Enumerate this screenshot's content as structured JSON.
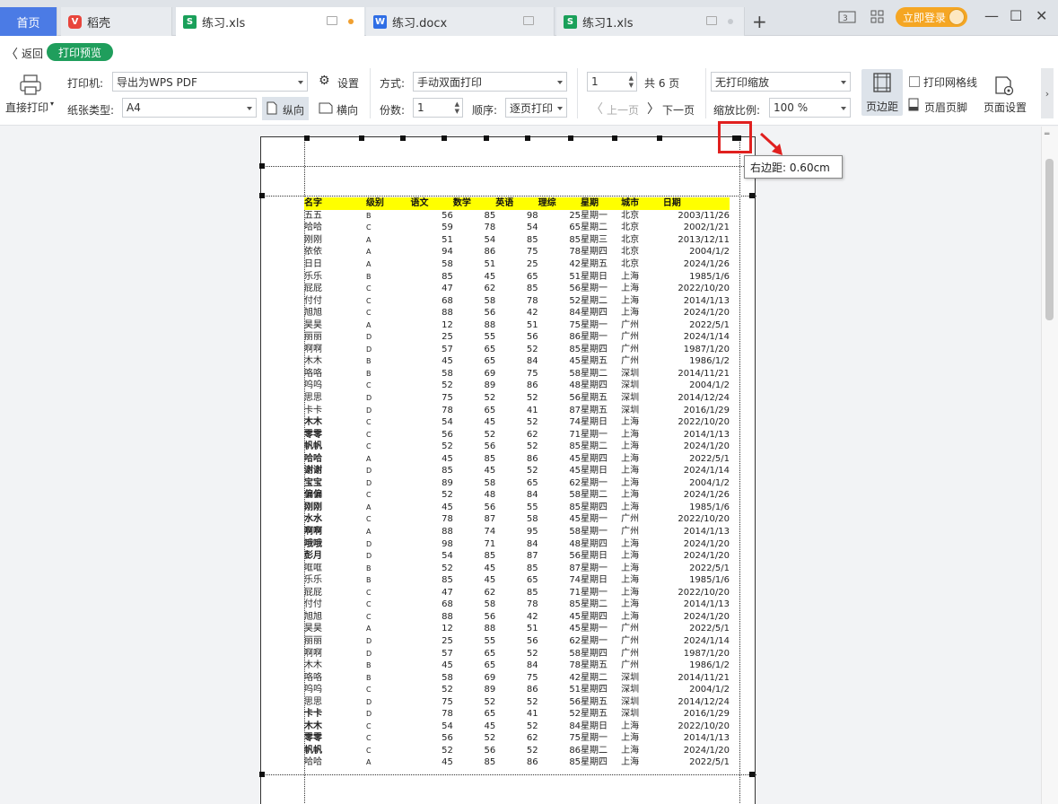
{
  "tabs": [
    {
      "label": "首页",
      "kind": "home"
    },
    {
      "label": "稻壳",
      "icon": "docer-icon"
    },
    {
      "label": "练习.xls",
      "icon": "spreadsheet-icon",
      "active": true,
      "modified": true
    },
    {
      "label": "练习.docx",
      "icon": "word-document-icon"
    },
    {
      "label": "练习1.xls",
      "icon": "spreadsheet-icon"
    }
  ],
  "header": {
    "login_label": "立即登录"
  },
  "toolbar": {
    "back_label": "返回",
    "preview_badge": "打印预览",
    "direct_print_label": "直接打印",
    "printer_label": "打印机:",
    "printer_value": "导出为WPS PDF",
    "settings_label": "设置",
    "paper_type_label": "纸张类型:",
    "paper_type_value": "A4",
    "portrait_label": "纵向",
    "landscape_label": "横向",
    "mode_label": "方式:",
    "mode_value": "手动双面打印",
    "copies_label": "份数:",
    "copies_value": "1",
    "order_label": "顺序:",
    "order_value": "逐页打印",
    "page_value": "1",
    "total_pages": "共 6 页",
    "prev_page_label": "上一页",
    "next_page_label": "下一页",
    "scaling_value": "无打印缩放",
    "zoom_label": "缩放比例:",
    "zoom_value": "100 %",
    "margins_label": "页边距",
    "gridlines_label": "打印网格线",
    "header_footer_label": "页眉页脚",
    "page_setup_label": "页面设置"
  },
  "tooltip": {
    "text": "右边距:   0.60cm"
  },
  "sheet": {
    "headers": [
      "名字",
      "级别",
      "语文",
      "数学",
      "英语",
      "理综",
      "星期",
      "城市",
      "日期"
    ],
    "rows": [
      [
        "五五",
        "B",
        "56",
        "85",
        "98",
        "25",
        "星期一",
        "北京",
        "2003/11/26"
      ],
      [
        "哈哈",
        "C",
        "59",
        "78",
        "54",
        "65",
        "星期二",
        "北京",
        "2002/1/21"
      ],
      [
        "刚刚",
        "A",
        "51",
        "54",
        "85",
        "85",
        "星期三",
        "北京",
        "2013/12/11"
      ],
      [
        "依依",
        "A",
        "94",
        "86",
        "75",
        "78",
        "星期四",
        "北京",
        "2004/1/2"
      ],
      [
        "日日",
        "A",
        "58",
        "51",
        "25",
        "42",
        "星期五",
        "北京",
        "2024/1/26"
      ],
      [
        "乐乐",
        "B",
        "85",
        "45",
        "65",
        "51",
        "星期日",
        "上海",
        "1985/1/6"
      ],
      [
        "屁屁",
        "C",
        "47",
        "62",
        "85",
        "56",
        "星期一",
        "上海",
        "2022/10/20"
      ],
      [
        "付付",
        "C",
        "68",
        "58",
        "78",
        "52",
        "星期二",
        "上海",
        "2014/1/13"
      ],
      [
        "旭旭",
        "C",
        "88",
        "56",
        "42",
        "84",
        "星期四",
        "上海",
        "2024/1/20"
      ],
      [
        "昊昊",
        "A",
        "12",
        "88",
        "51",
        "75",
        "星期一",
        "广州",
        "2022/5/1"
      ],
      [
        "丽丽",
        "D",
        "25",
        "55",
        "56",
        "86",
        "星期一",
        "广州",
        "2024/1/14"
      ],
      [
        "啊啊",
        "D",
        "57",
        "65",
        "52",
        "85",
        "星期四",
        "广州",
        "1987/1/20"
      ],
      [
        "木木",
        "B",
        "45",
        "65",
        "84",
        "45",
        "星期五",
        "广州",
        "1986/1/2"
      ],
      [
        "咯咯",
        "B",
        "58",
        "69",
        "75",
        "58",
        "星期二",
        "深圳",
        "2014/11/21"
      ],
      [
        "呜呜",
        "C",
        "52",
        "89",
        "86",
        "48",
        "星期四",
        "深圳",
        "2004/1/2"
      ],
      [
        "思思",
        "D",
        "75",
        "52",
        "52",
        "56",
        "星期五",
        "深圳",
        "2014/12/24"
      ],
      [
        "卡卡",
        "D",
        "78",
        "65",
        "41",
        "87",
        "星期五",
        "深圳",
        "2016/1/29"
      ],
      [
        "木木",
        "C",
        "54",
        "45",
        "52",
        "74",
        "星期日",
        "上海",
        "2022/10/20"
      ],
      [
        "零零",
        "C",
        "56",
        "52",
        "62",
        "71",
        "星期一",
        "上海",
        "2014/1/13"
      ],
      [
        "帆帆",
        "C",
        "52",
        "56",
        "52",
        "85",
        "星期二",
        "上海",
        "2024/1/20"
      ],
      [
        "哈哈",
        "A",
        "45",
        "85",
        "86",
        "45",
        "星期四",
        "上海",
        "2022/5/1"
      ],
      [
        "谢谢",
        "D",
        "85",
        "45",
        "52",
        "45",
        "星期日",
        "上海",
        "2024/1/14"
      ],
      [
        "宝宝",
        "D",
        "89",
        "58",
        "65",
        "62",
        "星期一",
        "上海",
        "2004/1/2"
      ],
      [
        "偏偏",
        "C",
        "52",
        "48",
        "84",
        "58",
        "星期二",
        "上海",
        "2024/1/26"
      ],
      [
        "刚刚",
        "A",
        "45",
        "56",
        "55",
        "85",
        "星期四",
        "上海",
        "1985/1/6"
      ],
      [
        "水水",
        "C",
        "78",
        "87",
        "58",
        "45",
        "星期一",
        "广州",
        "2022/10/20"
      ],
      [
        "啊啊",
        "A",
        "88",
        "74",
        "95",
        "58",
        "星期一",
        "广州",
        "2014/1/13"
      ],
      [
        "哦哦",
        "D",
        "98",
        "71",
        "84",
        "48",
        "星期四",
        "上海",
        "2024/1/20"
      ],
      [
        "彭月",
        "D",
        "54",
        "85",
        "87",
        "56",
        "星期日",
        "上海",
        "2024/1/20"
      ],
      [
        "哐哐",
        "B",
        "52",
        "45",
        "85",
        "87",
        "星期一",
        "上海",
        "2022/5/1"
      ],
      [
        "乐乐",
        "B",
        "85",
        "45",
        "65",
        "74",
        "星期日",
        "上海",
        "1985/1/6"
      ],
      [
        "屁屁",
        "C",
        "47",
        "62",
        "85",
        "71",
        "星期一",
        "上海",
        "2022/10/20"
      ],
      [
        "付付",
        "C",
        "68",
        "58",
        "78",
        "85",
        "星期二",
        "上海",
        "2014/1/13"
      ],
      [
        "旭旭",
        "C",
        "88",
        "56",
        "42",
        "45",
        "星期四",
        "上海",
        "2024/1/20"
      ],
      [
        "昊昊",
        "A",
        "12",
        "88",
        "51",
        "45",
        "星期一",
        "广州",
        "2022/5/1"
      ],
      [
        "丽丽",
        "D",
        "25",
        "55",
        "56",
        "62",
        "星期一",
        "广州",
        "2024/1/14"
      ],
      [
        "啊啊",
        "D",
        "57",
        "65",
        "52",
        "58",
        "星期四",
        "广州",
        "1987/1/20"
      ],
      [
        "木木",
        "B",
        "45",
        "65",
        "84",
        "78",
        "星期五",
        "广州",
        "1986/1/2"
      ],
      [
        "咯咯",
        "B",
        "58",
        "69",
        "75",
        "42",
        "星期二",
        "深圳",
        "2014/11/21"
      ],
      [
        "呜呜",
        "C",
        "52",
        "89",
        "86",
        "51",
        "星期四",
        "深圳",
        "2004/1/2"
      ],
      [
        "思思",
        "D",
        "75",
        "52",
        "52",
        "56",
        "星期五",
        "深圳",
        "2014/12/24"
      ],
      [
        "卡卡",
        "D",
        "78",
        "65",
        "41",
        "52",
        "星期五",
        "深圳",
        "2016/1/29"
      ],
      [
        "木木",
        "C",
        "54",
        "45",
        "52",
        "84",
        "星期日",
        "上海",
        "2022/10/20"
      ],
      [
        "零零",
        "C",
        "56",
        "52",
        "62",
        "75",
        "星期一",
        "上海",
        "2014/1/13"
      ],
      [
        "帆帆",
        "C",
        "52",
        "56",
        "52",
        "86",
        "星期二",
        "上海",
        "2024/1/20"
      ],
      [
        "哈哈",
        "A",
        "45",
        "85",
        "86",
        "85",
        "星期四",
        "上海",
        "2022/5/1"
      ]
    ]
  },
  "colors": {
    "accent": "#4b7be5",
    "preview_badge": "#1f9e5c",
    "header_fill": "#ffff00",
    "highlight": "#e0201f",
    "login": "#f5a623"
  }
}
